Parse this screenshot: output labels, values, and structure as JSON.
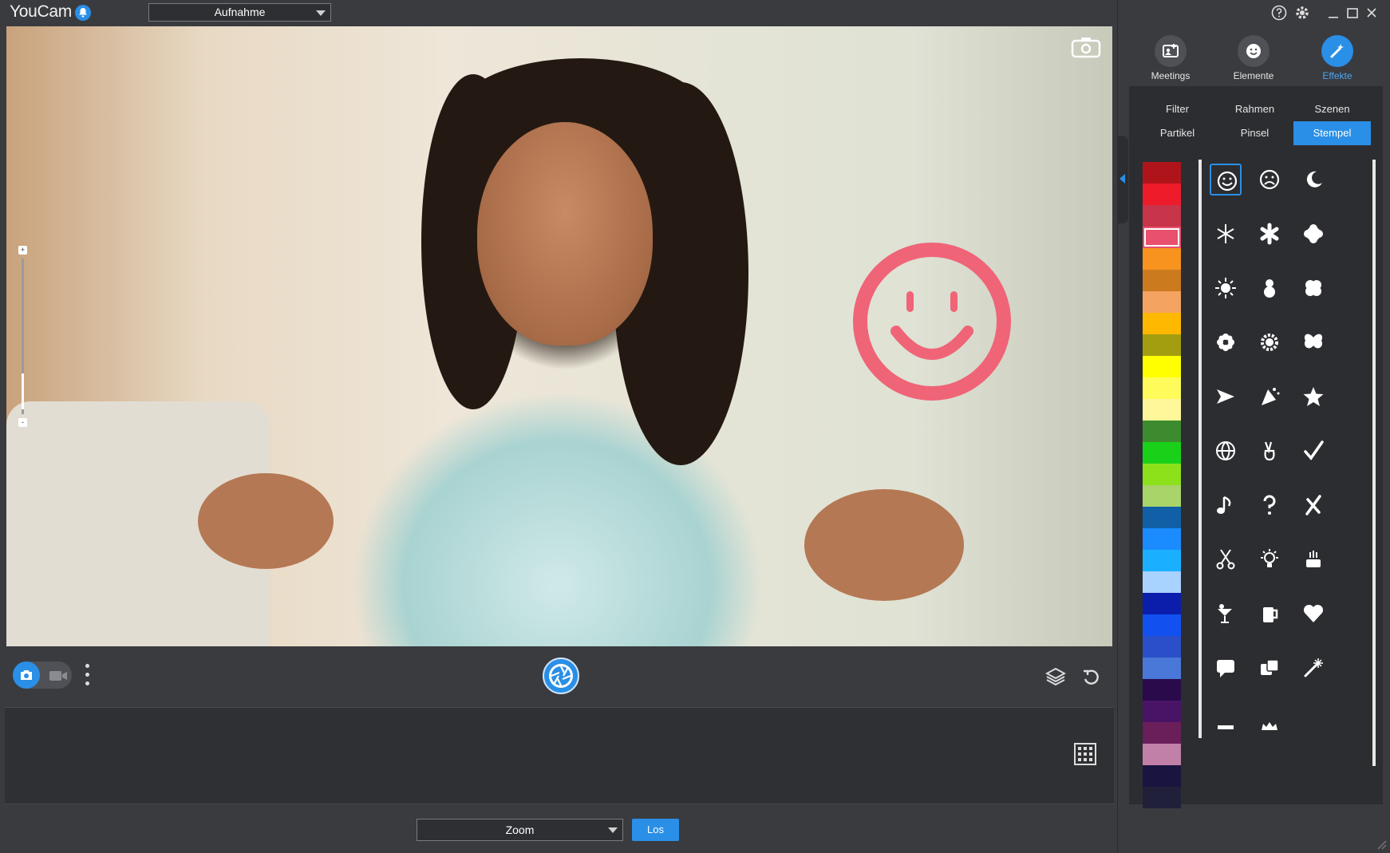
{
  "app": {
    "title": "YouCam"
  },
  "topbar": {
    "mode_value": "Aufnahme",
    "notification_icon": "bell-icon"
  },
  "camera": {
    "rotate_icon": "camera-rotate-icon",
    "zoom_top": "+",
    "zoom_bottom": "-"
  },
  "controls": {
    "photo_icon": "camera-icon",
    "video_icon": "video-icon",
    "more_icon": "more-vertical-icon",
    "shutter_icon": "shutter-icon",
    "layers_icon": "layers-icon",
    "undo_icon": "undo-icon"
  },
  "gallery": {
    "grid_icon": "grid-view-icon"
  },
  "bottom": {
    "zoom_value": "Zoom",
    "go_label": "Los"
  },
  "window": {
    "help_icon": "help-icon",
    "settings_icon": "gear-icon",
    "minimize_icon": "minimize-icon",
    "maximize_icon": "maximize-icon",
    "close_icon": "close-icon"
  },
  "main_tabs": [
    {
      "label": "Meetings",
      "icon": "meetings-icon"
    },
    {
      "label": "Elemente",
      "icon": "sticker-icon"
    },
    {
      "label": "Effekte",
      "icon": "magic-wand-icon",
      "active": true
    }
  ],
  "sub_tabs": [
    {
      "label": "Filter"
    },
    {
      "label": "Rahmen"
    },
    {
      "label": "Szenen"
    },
    {
      "label": "Partikel"
    },
    {
      "label": "Pinsel"
    },
    {
      "label": "Stempel",
      "active": true
    }
  ],
  "palette": [
    "#b0141b",
    "#ee1c2a",
    "#c8344a",
    "#e8506e",
    "#f7931e",
    "#cc7a1e",
    "#f4a460",
    "#ffb800",
    "#a39e10",
    "#ffff00",
    "#fffb5a",
    "#fff79a",
    "#3c8c2f",
    "#1ad11a",
    "#8ce11a",
    "#a8d46a",
    "#115fa6",
    "#1a8cff",
    "#1ab0ff",
    "#a8d2ff",
    "#0a1eab",
    "#1250f0",
    "#2a4fc8",
    "#4a78d8",
    "#2a0a4a",
    "#4a1466",
    "#6a1e5a",
    "#c080a8",
    "#1a1440",
    "#20203a"
  ],
  "palette_selected": 3,
  "stamps": [
    "smiley-icon",
    "frown-icon",
    "moon-icon",
    "snowflake-icon",
    "asterisk-icon",
    "cloud-icon",
    "sun-icon",
    "snowman-icon",
    "clover-icon",
    "flower-icon",
    "gear-flower-icon",
    "butterfly-icon",
    "airplane-icon",
    "party-icon",
    "star-icon",
    "globe-icon",
    "peace-icon",
    "check-icon",
    "music-note-icon",
    "question-icon",
    "cross-icon",
    "scissors-icon",
    "lightbulb-icon",
    "cake-icon",
    "cocktail-icon",
    "beer-icon",
    "heart-icon",
    "speech-bubble-icon",
    "dice-icon",
    "sparkler-icon",
    "pencil-icon",
    "crown-icon"
  ],
  "colors": {
    "accent": "#2a8fe6",
    "bg": "#3a3b3f",
    "stamp": "#f06477"
  }
}
